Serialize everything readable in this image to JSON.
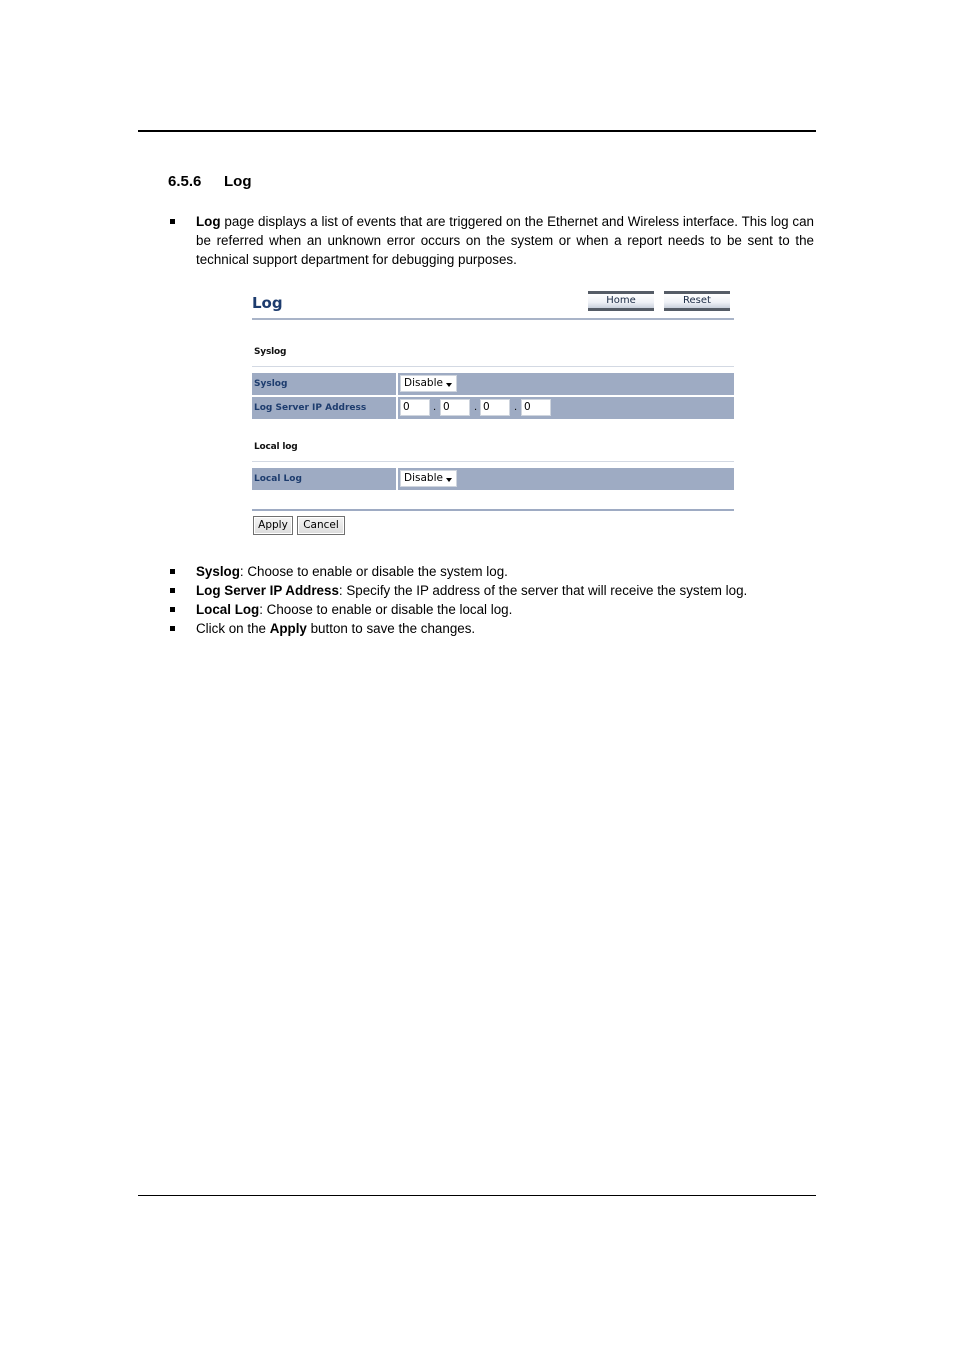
{
  "section": {
    "number": "6.5.6",
    "title": "Log"
  },
  "intro": {
    "bold": "Log",
    "text": " page displays a list of events that are triggered on the Ethernet and Wireless interface. This log can be referred when an unknown error occurs on the system or when a report needs to be sent to the technical support department for debugging purposes."
  },
  "ui": {
    "title": "Log",
    "home_label": "Home",
    "reset_label": "Reset",
    "syslog_section": "Syslog",
    "syslog_label": "Syslog",
    "syslog_value": "Disable",
    "server_ip_label": "Log Server IP Address",
    "ip": [
      "0",
      "0",
      "0",
      "0"
    ],
    "local_section": "Local log",
    "local_label": "Local Log",
    "local_value": "Disable",
    "apply_label": "Apply",
    "cancel_label": "Cancel",
    "colors": {
      "row_bg": "#9eabc3",
      "title": "#1d3c6e"
    }
  },
  "bullets": [
    {
      "bold": "Syslog",
      "text": ": Choose to enable or disable the system log."
    },
    {
      "bold": "Log Server IP Address",
      "text": ": Specify the IP address of the server that will receive the system log."
    },
    {
      "bold": "Local Log",
      "text": ": Choose to enable or disable the local log."
    },
    {
      "pre": "Click on the ",
      "bold": "Apply",
      "text": " button to save the changes."
    }
  ]
}
